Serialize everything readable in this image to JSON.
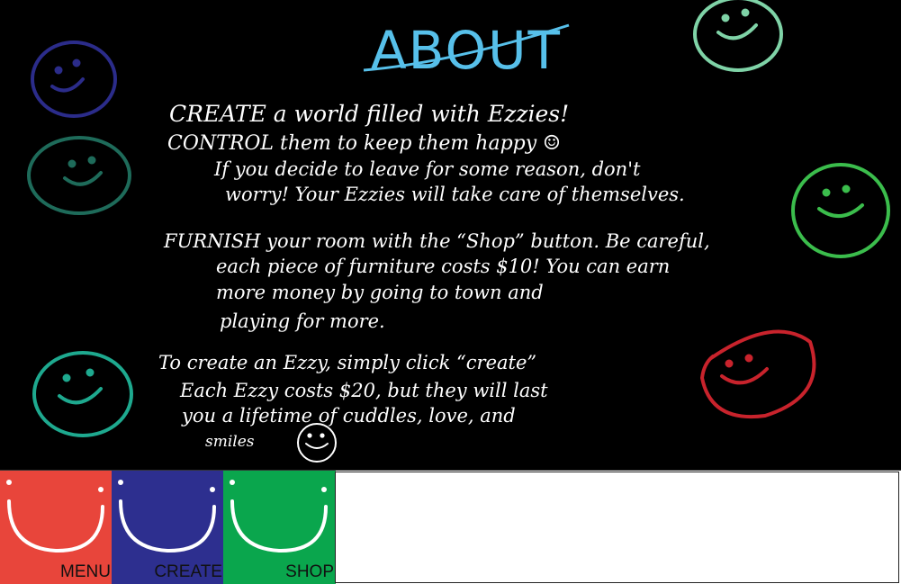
{
  "about": {
    "title": "ABOUT",
    "lines": [
      "CREATE  a world filled with Ezzies!",
      "CONTROL  them to keep them happy  ☺",
      "If you decide to leave for some reason, don't",
      "worry! Your Ezzies will take care of themselves.",
      "FURNISH your room with the “Shop” button. Be careful,",
      "each piece of furniture costs $10! You can earn",
      "more money by going to town and",
      "playing for more.",
      "To create an Ezzy, simply click “create”",
      "Each Ezzy costs $20, but they will last",
      "you a lifetime of cuddles, love, and",
      "smiles"
    ]
  },
  "decorations": {
    "smiley_icon": "smiley-face-icon",
    "smiley_colors": [
      "#2b2c8a",
      "#1e6b5a",
      "#1ea98f",
      "#7fd3a7",
      "#3bbd4c",
      "#c8232c"
    ]
  },
  "nav": {
    "menu_label": "MENU",
    "create_label": "CREATE",
    "shop_label": "SHOP",
    "menu_color": "#e8453b",
    "create_color": "#2d2f8f",
    "shop_color": "#0aa64d"
  }
}
